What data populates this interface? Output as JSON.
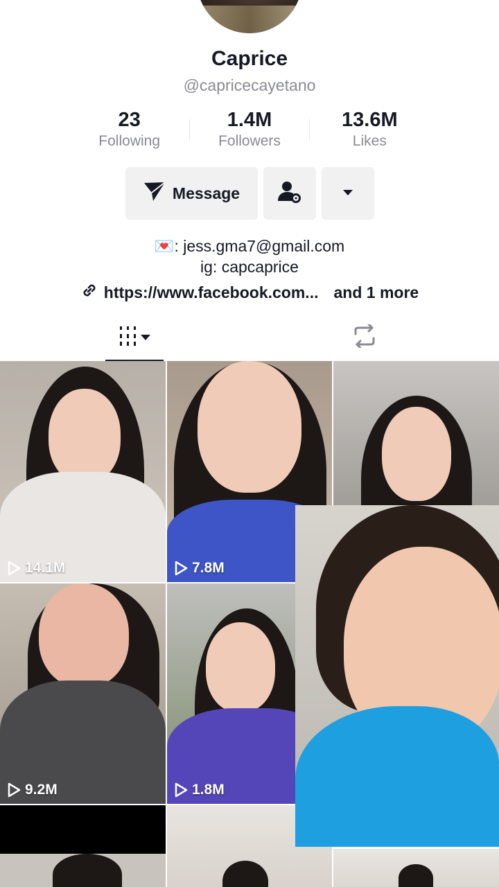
{
  "profile": {
    "display_name": "Caprice",
    "username": "@capricecayetano"
  },
  "stats": [
    {
      "value": "23",
      "label": "Following"
    },
    {
      "value": "1.4M",
      "label": "Followers"
    },
    {
      "value": "13.6M",
      "label": "Likes"
    }
  ],
  "actions": {
    "message_label": "Message",
    "message_icon": "paper-plane-icon",
    "settings_icon": "user-gear-icon",
    "more_icon": "caret-down-icon"
  },
  "bio": {
    "line1": ": jess.gma7@gmail.com",
    "line1_emoji": "💌",
    "line2": "ig: capcaprice"
  },
  "link": {
    "url": "https://www.facebook.com...",
    "more": "and 1 more",
    "icon": "link-icon"
  },
  "tabs": {
    "videos_icon": "grid-icon",
    "reposts_icon": "repost-icon"
  },
  "videos": [
    {
      "views": "14.1M"
    },
    {
      "views": "7.8M"
    },
    {
      "views": ""
    },
    {
      "views": "9.2M"
    },
    {
      "views": "1.8M"
    }
  ],
  "colors": {
    "text": "#161823",
    "secondary": "#8a8b91",
    "button_bg": "#f1f1f2",
    "overlay_shirt": "#1e9fe0"
  }
}
